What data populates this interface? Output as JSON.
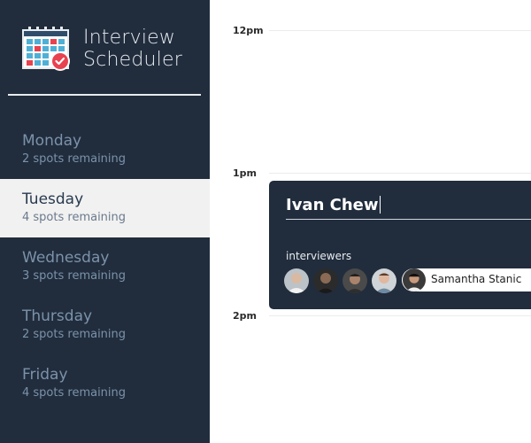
{
  "app": {
    "title_line1": "Interview",
    "title_line2": "Scheduler",
    "logo_icon": "calendar-check-icon"
  },
  "sidebar": {
    "days": [
      {
        "name": "Monday",
        "spots": "2 spots remaining",
        "active": false
      },
      {
        "name": "Tuesday",
        "spots": "4 spots remaining",
        "active": true
      },
      {
        "name": "Wednesday",
        "spots": "3 spots remaining",
        "active": false
      },
      {
        "name": "Thursday",
        "spots": "2 spots remaining",
        "active": false
      },
      {
        "name": "Friday",
        "spots": "4 spots remaining",
        "active": false
      }
    ]
  },
  "schedule": {
    "slots": [
      "12pm",
      "1pm",
      "2pm"
    ],
    "appointment": {
      "student_name": "Ivan Chew",
      "interviewers_label": "interviewers",
      "selected_interviewer": "Samantha Stanic",
      "interviewer_avatar_count": 5
    }
  },
  "colors": {
    "sidebar_bg": "#212d3d",
    "active_day_bg": "#f1f1f1",
    "accent_red": "#e8424f"
  }
}
